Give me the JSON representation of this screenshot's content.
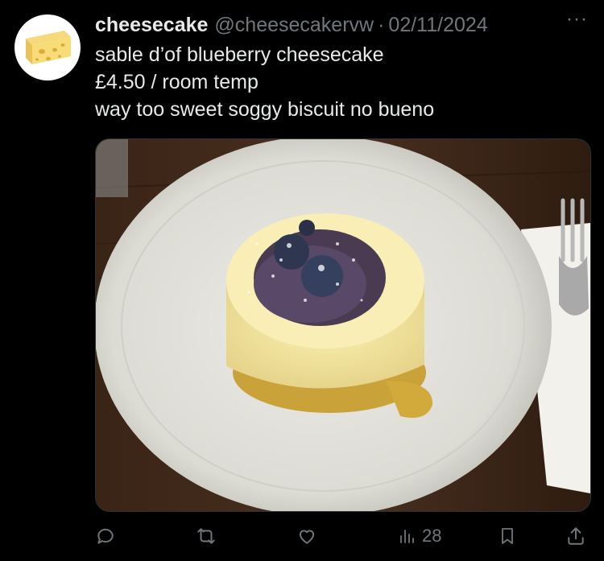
{
  "post": {
    "display_name": "cheesecake",
    "handle": "@cheesecakervw",
    "separator": "·",
    "date": "02/11/2024",
    "more": "···",
    "lines": [
      "sable d’of blueberry cheesecake",
      "£4.50 / room temp",
      "way too sweet soggy biscuit no bueno"
    ]
  },
  "avatar": {
    "icon": "cheese-icon",
    "background": "#ffffff"
  },
  "media": {
    "description_icon": "cheesecake-photo"
  },
  "actions": {
    "reply": {
      "icon": "reply-icon"
    },
    "repost": {
      "icon": "repost-icon"
    },
    "like": {
      "icon": "heart-icon"
    },
    "views": {
      "icon": "views-icon",
      "count": "28"
    },
    "bookmark": {
      "icon": "bookmark-icon"
    },
    "share": {
      "icon": "share-icon"
    }
  },
  "colors": {
    "text": "#e7e9ea",
    "muted": "#71767b",
    "background": "#000000"
  }
}
